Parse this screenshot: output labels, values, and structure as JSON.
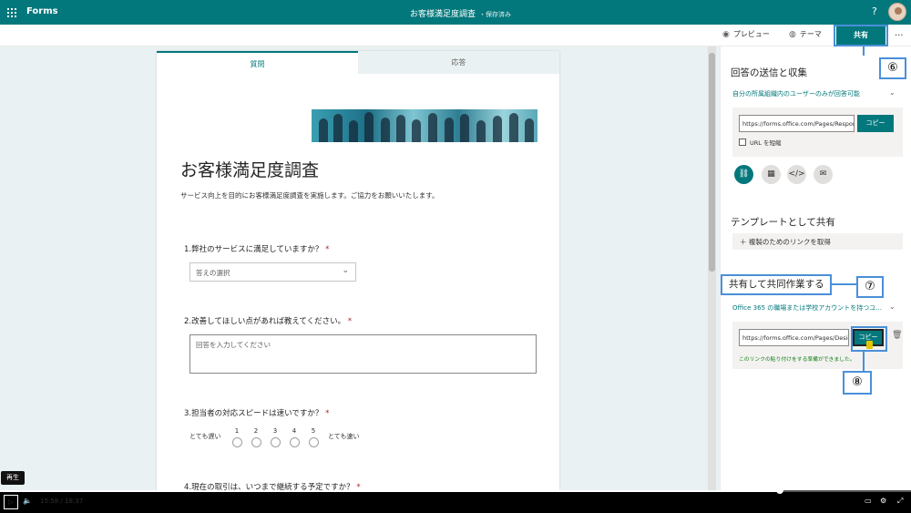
{
  "topbar": {
    "app_name": "Forms",
    "doc_title": "お客様満足度調査",
    "saved_status": "・保存済み",
    "help": "?"
  },
  "commandbar": {
    "preview": "プレビュー",
    "theme": "テーマ",
    "share": "共有",
    "more": "..."
  },
  "tabs": [
    {
      "label": "質問"
    },
    {
      "label": "応答"
    }
  ],
  "form": {
    "title": "お客様満足度調査",
    "description": "サービス向上を目的にお客様満足度調査を実施します。ご協力をお願いいたします。",
    "questions": [
      {
        "text": "1.弊社のサービスに満足していますか？",
        "required": "*",
        "placeholder": "答えの選択"
      },
      {
        "text": "2.改善してほしい点があれば教えてください。",
        "required": "*",
        "placeholder": "回答を入力してください"
      },
      {
        "text": "3.担当者の対応スピードは速いですか？",
        "required": "*",
        "rating_low": "とても遅い",
        "rating_high": "とても速い",
        "scale": [
          "1",
          "2",
          "3",
          "4",
          "5"
        ]
      },
      {
        "text": "4.現在の取引は、いつまで継続する予定ですか？",
        "required": "*"
      }
    ]
  },
  "share_pane": {
    "send_heading": "回答の送信と収集",
    "send_scope": "自分の所属組織内のユーザーのみが回答可能",
    "send_url": "https://forms.office.com/Pages/ResponsePage.aspx",
    "copy_label": "コピー",
    "shorten_label": "URL を短縮",
    "template_heading": "テンプレートとして共有",
    "template_action": "複製のためのリンクを取得",
    "collab_heading": "共有して共同作業する",
    "collab_scope": "Office 365 の職場または学校アカウントを持つユ...",
    "collab_url": "https://forms.office.com/Pages/DesignPage.aspx",
    "collab_copy_label": "コピー",
    "collab_ready": "このリンクの貼り付けをする準備ができました。"
  },
  "callouts": {
    "six": "⑥",
    "seven": "⑦",
    "eight": "⑧"
  },
  "video": {
    "tooltip": "再生",
    "current_time": "15:58",
    "separator": "/",
    "total_time": "18:37",
    "progress": 0.857
  },
  "colors": {
    "brand": "#03787c",
    "callout": "#4a90d9"
  }
}
